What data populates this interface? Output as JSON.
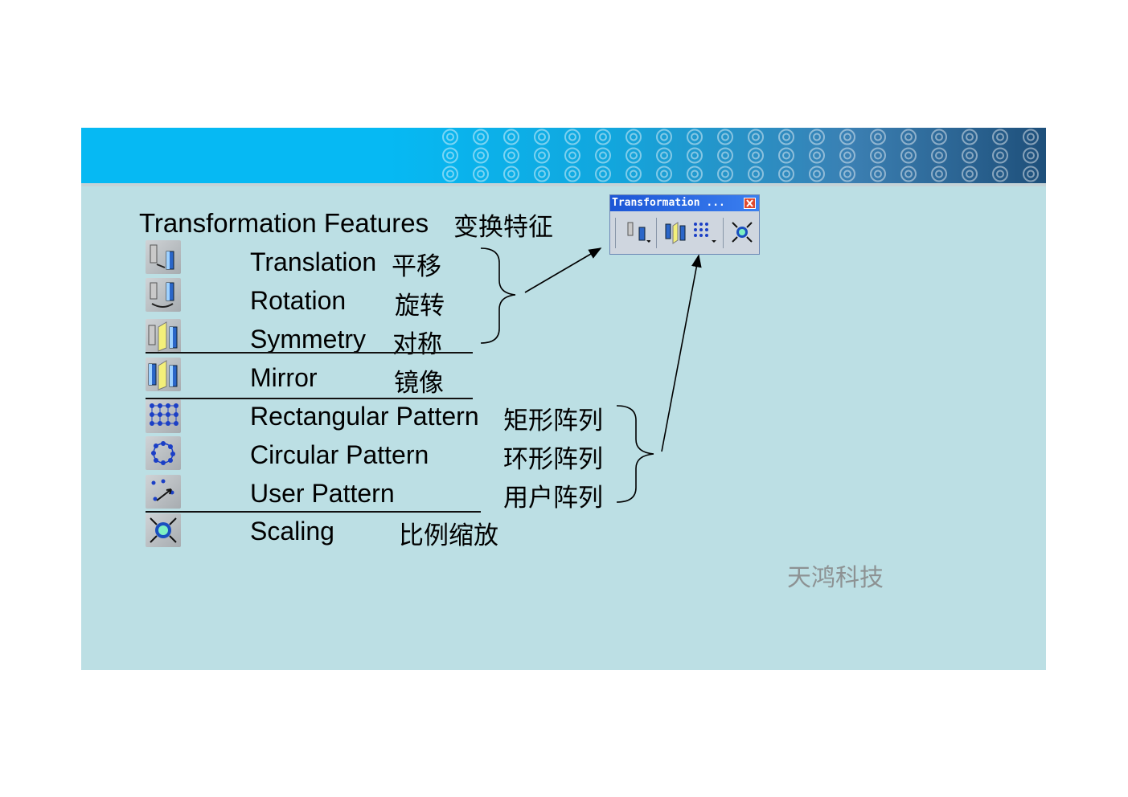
{
  "heading": {
    "en": "Transformation Features",
    "cn": "变换特征"
  },
  "features": [
    {
      "icon": "translation-icon",
      "en": "Translation",
      "cn": "平移"
    },
    {
      "icon": "rotation-icon",
      "en": "Rotation",
      "cn": "旋转"
    },
    {
      "icon": "symmetry-icon",
      "en": "Symmetry",
      "cn": "对称"
    },
    {
      "icon": "mirror-icon",
      "en": "Mirror",
      "cn": "镜像"
    },
    {
      "icon": "rectangular-pattern-icon",
      "en": "Rectangular Pattern",
      "cn": "矩形阵列"
    },
    {
      "icon": "circular-pattern-icon",
      "en": "Circular Pattern",
      "cn": "环形阵列"
    },
    {
      "icon": "user-pattern-icon",
      "en": "User Pattern",
      "cn": "用户阵列"
    },
    {
      "icon": "scaling-icon",
      "en": "Scaling",
      "cn": "比例缩放"
    }
  ],
  "toolbar": {
    "title": "Transformation ...",
    "buttons": [
      "translation-icon",
      "mirror-icon",
      "rectangular-pattern-icon",
      "scaling-icon"
    ]
  },
  "watermark": "天鸿科技",
  "colors": {
    "banner": "#06b9f3",
    "slide_bg": "#bcdfe4",
    "toolbar_title": "#1c56d6"
  }
}
